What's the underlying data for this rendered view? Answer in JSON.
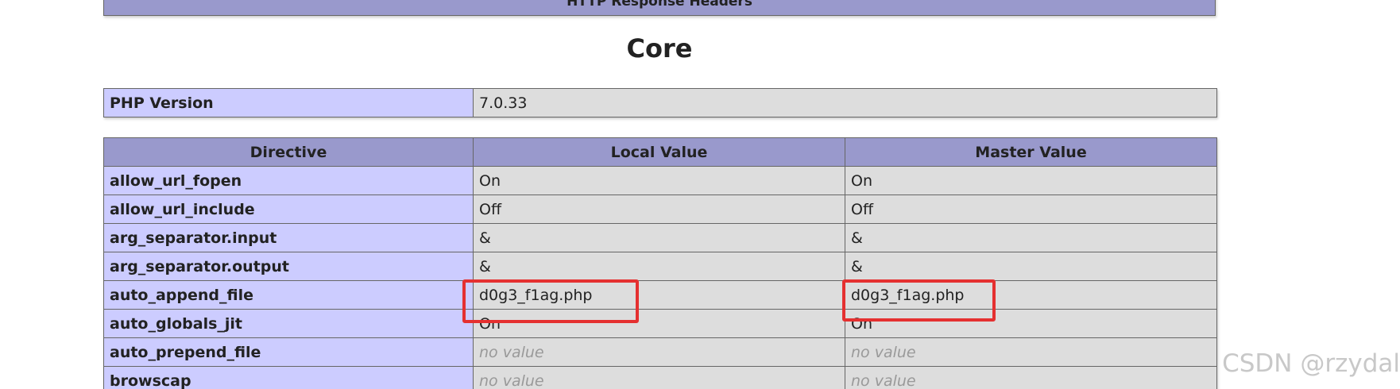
{
  "top_section": {
    "header": "HTTP Response Headers"
  },
  "core": {
    "title": "Core",
    "version_label": "PHP Version",
    "version_value": "7.0.33",
    "columns": [
      "Directive",
      "Local Value",
      "Master Value"
    ],
    "rows": [
      {
        "directive": "allow_url_fopen",
        "local": "On",
        "master": "On",
        "no_value": false
      },
      {
        "directive": "allow_url_include",
        "local": "Off",
        "master": "Off",
        "no_value": false
      },
      {
        "directive": "arg_separator.input",
        "local": "&",
        "master": "&",
        "no_value": false
      },
      {
        "directive": "arg_separator.output",
        "local": "&",
        "master": "&",
        "no_value": false
      },
      {
        "directive": "auto_append_file",
        "local": "d0g3_f1ag.php",
        "master": "d0g3_f1ag.php",
        "no_value": false
      },
      {
        "directive": "auto_globals_jit",
        "local": "On",
        "master": "On",
        "no_value": false
      },
      {
        "directive": "auto_prepend_file",
        "local": "no value",
        "master": "no value",
        "no_value": true
      },
      {
        "directive": "browscap",
        "local": "no value",
        "master": "no value",
        "no_value": true
      }
    ]
  },
  "highlight_color": "#e53030",
  "watermark": "CSDN @rzydal"
}
